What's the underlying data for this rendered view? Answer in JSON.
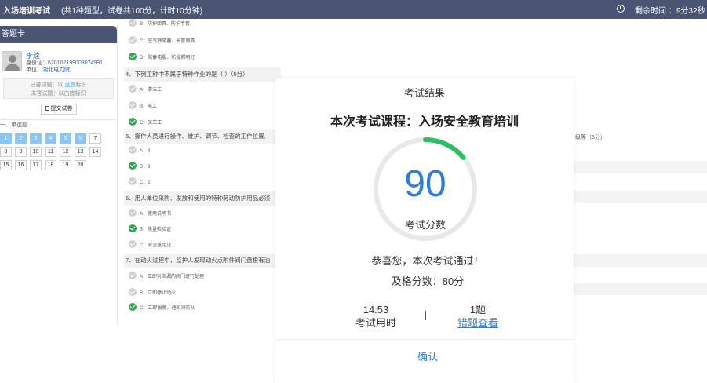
{
  "header": {
    "title": "入场培训考试",
    "info": "(共1种题型，试卷共100分，计时10分钟)",
    "remaining_label": "剩余时间 ：",
    "remaining_time": "9分32秒"
  },
  "sidebar": {
    "card_title": "答题卡",
    "user_name": "李逵",
    "id_label": "身份证：",
    "id_value": "620102199003074991",
    "unit_label": "单位：",
    "unit_value": "湖北电力院",
    "legend_answered_a": "已答试题：以 ",
    "legend_answered_b": "蓝底",
    "legend_answered_c": "标识",
    "legend_unanswered": "未答试题：以白底标识",
    "submit_label": "提交试卷",
    "section_name": "一、单选题",
    "answer_cells": [
      {
        "num": "1",
        "done": true
      },
      {
        "num": "2",
        "done": true
      },
      {
        "num": "3",
        "done": true
      },
      {
        "num": "4",
        "done": true
      },
      {
        "num": "5",
        "done": true
      },
      {
        "num": "6",
        "done": true
      },
      {
        "num": "7",
        "done": false
      },
      {
        "num": "8",
        "done": false
      },
      {
        "num": "9",
        "done": false
      },
      {
        "num": "10",
        "done": false
      },
      {
        "num": "11",
        "done": false
      },
      {
        "num": "12",
        "done": false
      },
      {
        "num": "13",
        "done": false
      },
      {
        "num": "14",
        "done": false
      },
      {
        "num": "15",
        "done": false
      },
      {
        "num": "16",
        "done": false
      },
      {
        "num": "17",
        "done": false
      },
      {
        "num": "18",
        "done": false
      },
      {
        "num": "19",
        "done": false
      },
      {
        "num": "20",
        "done": false
      }
    ]
  },
  "questions": {
    "q3_opt_b": "B：防护面具、防护手套",
    "q3_opt_c": "C：空气呼吸器、长管面具",
    "q3_opt_d": "D：防静电服、防爆照明灯",
    "q4_text": "4、下列工种中不属于特种作业的是（ ）（5分）",
    "q4_opt_a": "A：清洁工",
    "q4_opt_b": "B：电工",
    "q4_opt_c": "C：叉车工",
    "q5_text": "5、操作人员进行操作、维护、调节、检查的工作位置,",
    "q5_tail": "级等（5分）",
    "q5_opt_a": "A：4",
    "q5_opt_b": "B：3",
    "q5_opt_c": "C：2",
    "q6_text": "6、用人单位采购、发放和使用的特种劳动防护用品必须",
    "q6_opt_a": "A：使用说明书",
    "q6_opt_b": "B：质量检验证",
    "q6_opt_c": "C：安全鉴定证",
    "q7_text": "7、在动火过程中，监护人发现动火点附件阀门盘根有油",
    "q7_opt_a": "A：立即对泄漏的阀门进行处理",
    "q7_opt_b": "B：立即停止动火",
    "q7_opt_c": "C：立即报警，通知消防队"
  },
  "modal": {
    "title": "考试结果",
    "course": "本次考试课程：入场安全教育培训",
    "score": "90",
    "score_fraction": 0.14,
    "score_label": "考试分数",
    "congrats": "恭喜您，本次考试通过！",
    "pass_line": "及格分数：80分",
    "duration_value": "14:53",
    "duration_label": "考试用时",
    "wrong_count": "1题",
    "wrong_link": "错题查看",
    "confirm": "确认",
    "gauge_color": "#2dbd64",
    "gauge_track": "#e8e8e8"
  }
}
